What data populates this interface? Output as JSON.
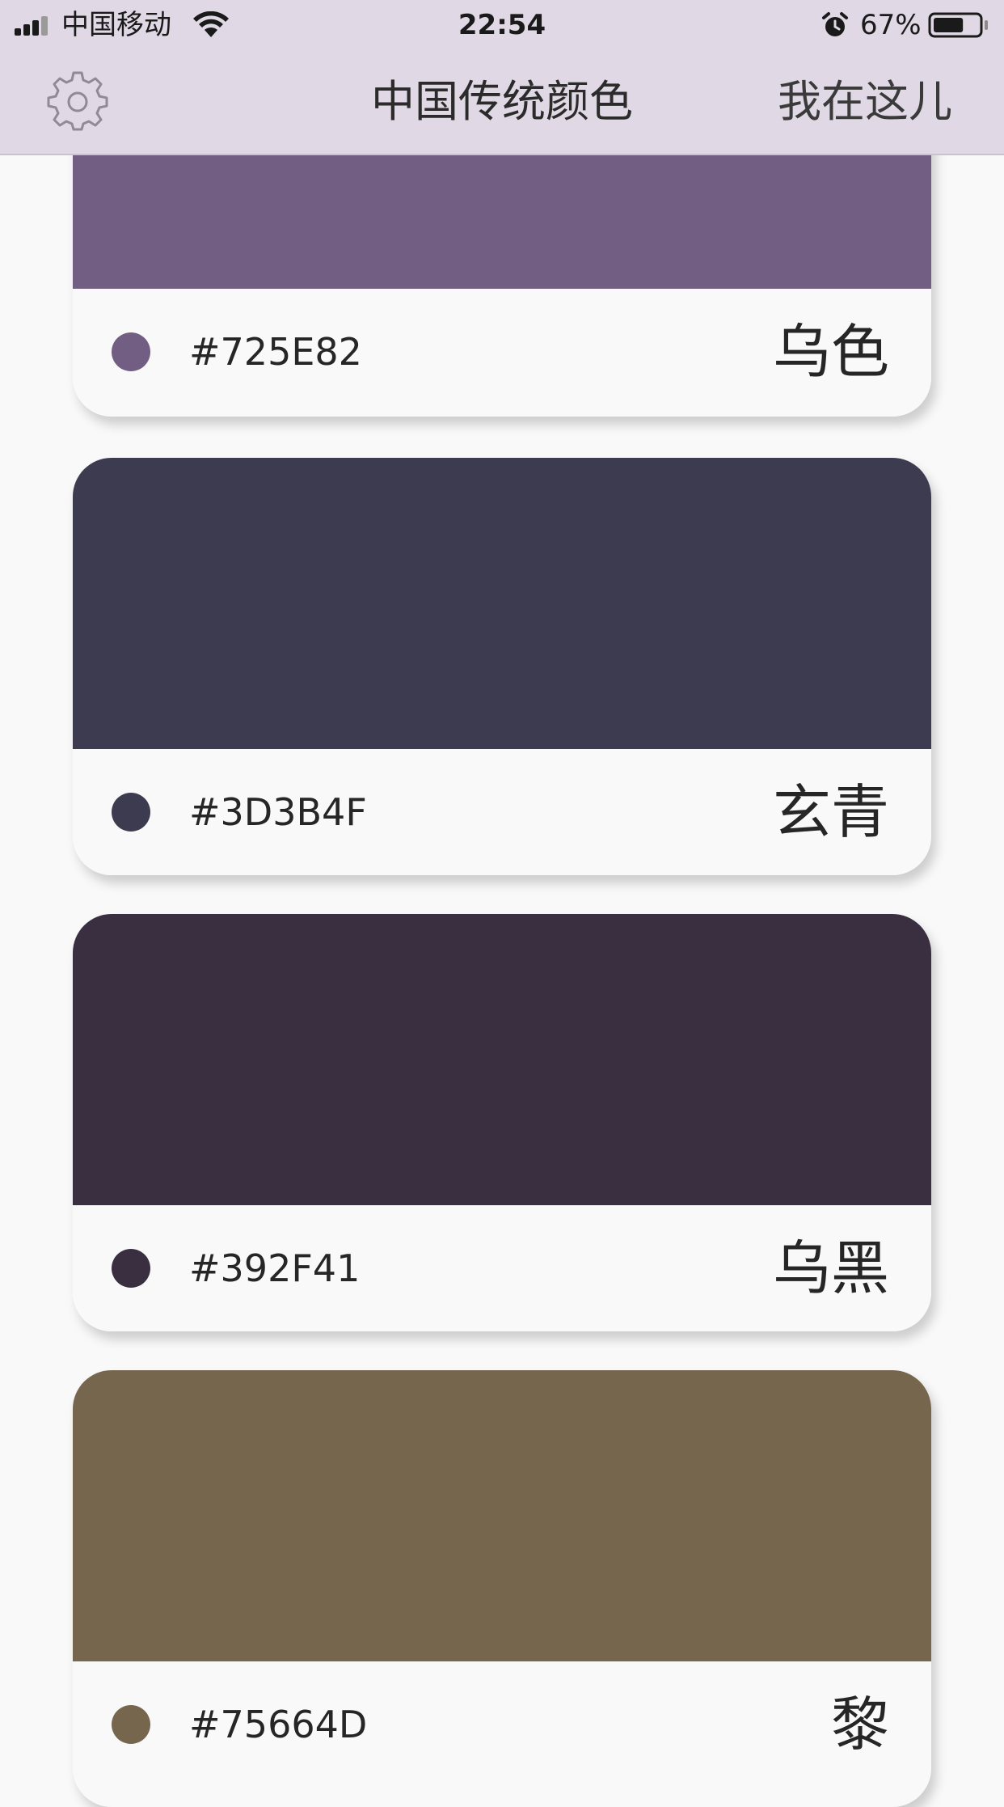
{
  "status_bar": {
    "carrier": "中国移动",
    "time": "22:54",
    "battery_percent": "67%",
    "battery_level": 0.67,
    "icons": [
      "signal-icon",
      "wifi-icon",
      "alarm-icon",
      "battery-icon"
    ]
  },
  "nav": {
    "title": "中国传统颜色",
    "action_label": "我在这儿",
    "settings_icon": "gear-icon",
    "background": "#E0D8E4"
  },
  "cards": [
    {
      "hex": "#725E82",
      "name": "乌色",
      "color": "#725E82"
    },
    {
      "hex": "#3D3B4F",
      "name": "玄青",
      "color": "#3D3B4F"
    },
    {
      "hex": "#392F41",
      "name": "乌黑",
      "color": "#392F41"
    },
    {
      "hex": "#75664D",
      "name": "黎",
      "color": "#75664D"
    }
  ]
}
